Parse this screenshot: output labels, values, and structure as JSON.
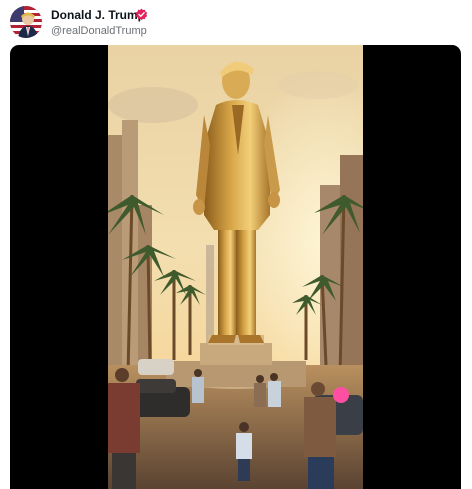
{
  "post": {
    "author": {
      "display_name": "Donald J. Trump",
      "handle": "@realDonaldTrump",
      "verified": true,
      "verified_color": "#e0245e",
      "avatar_icon": "avatar-flag-portrait"
    },
    "media": {
      "type": "video",
      "scene_icon": "golden-statue-scene",
      "background": "#000000"
    }
  }
}
